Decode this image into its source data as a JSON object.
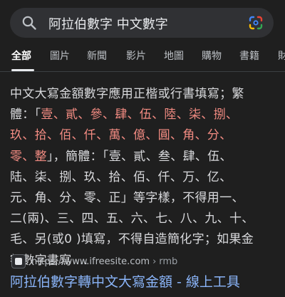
{
  "search": {
    "query": "阿拉伯數字 中文數字",
    "icons": [
      "search-icon",
      "google-lens-icon"
    ]
  },
  "tabs": [
    {
      "label": "全部",
      "active": true
    },
    {
      "label": "圖片",
      "active": false
    },
    {
      "label": "新聞",
      "active": false
    },
    {
      "label": "影片",
      "active": false
    },
    {
      "label": "地圖",
      "active": false
    },
    {
      "label": "購物",
      "active": false
    },
    {
      "label": "書籍",
      "active": false
    },
    {
      "label": "財",
      "active": false
    }
  ],
  "snippet": {
    "lines": [
      [
        {
          "t": "中文大寫金額數字應用正楷或行書填寫；繁",
          "h": false
        }
      ],
      [
        {
          "t": "體：「",
          "h": false
        },
        {
          "t": "壹、貳、參、肆、伍、陸、柒、捌、",
          "h": true
        }
      ],
      [
        {
          "t": "玖、拾、佰、仟、萬、億、圓、角、分、",
          "h": true
        }
      ],
      [
        {
          "t": "零、整",
          "h": true
        },
        {
          "t": "」，簡體：「壹、貳、叁、肆、伍、",
          "h": false
        }
      ],
      [
        {
          "t": "陆、柒、捌、玖、拾、佰、仟、万、亿、",
          "h": false
        }
      ],
      [
        {
          "t": "元、角、分、零、正」等字樣，不得用一、",
          "h": false
        }
      ],
      [
        {
          "t": "二(兩)、三、四、五、六、七、八、九、十、",
          "h": false
        }
      ],
      [
        {
          "t": "毛、另(或0 )填寫，不得自造簡化字；如果金",
          "h": false
        }
      ],
      [
        {
          "t": "額數字書寫 ...",
          "h": false
        }
      ]
    ]
  },
  "source": {
    "url": "https://www.ifreesite.com",
    "separator": "›",
    "path": "rmb"
  },
  "result": {
    "title": "阿拉伯數字轉中文大寫金額 - 線上工具"
  },
  "colors": {
    "background": "#1f1f1f",
    "highlight": "#f28b82",
    "link": "#8ab4f8"
  }
}
